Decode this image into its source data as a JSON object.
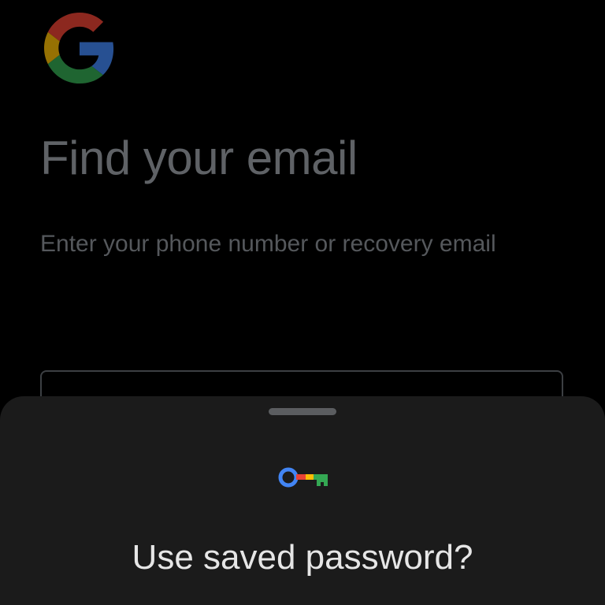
{
  "page": {
    "title": "Find your email",
    "subtitle": "Enter your phone number or recovery email"
  },
  "input": {
    "value": ""
  },
  "sheet": {
    "title": "Use saved password?"
  },
  "icons": {
    "logo": "google-g-logo",
    "key": "password-key-icon",
    "handle": "drag-handle"
  },
  "colors": {
    "background": "#000000",
    "sheet": "#1b1b1b",
    "google_blue": "#4285f4",
    "google_red": "#ea4335",
    "google_yellow": "#fbbc05",
    "google_green": "#34a853"
  }
}
